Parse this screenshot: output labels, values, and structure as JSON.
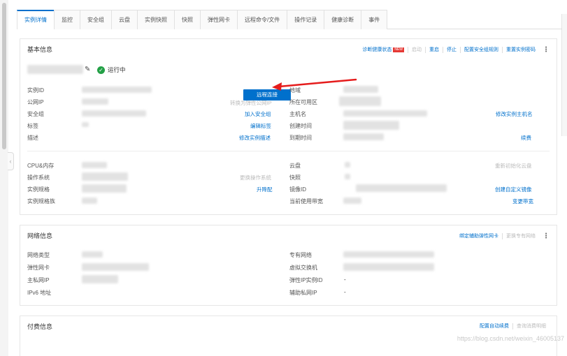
{
  "tabs": [
    "实例详情",
    "监控",
    "安全组",
    "云盘",
    "实例快照",
    "快照",
    "弹性网卡",
    "远程命令/文件",
    "操作记录",
    "健康诊断",
    "事件"
  ],
  "basic": {
    "title": "基本信息",
    "actions": {
      "diagnose": "诊断健康状态",
      "diagnose_badge": "NEW",
      "start": "启动",
      "restart": "重启",
      "stop": "停止",
      "config_sg": "配置安全组规则",
      "reset_pwd": "重置实例密码"
    },
    "status": "运行中",
    "remote_btn": "远程连接",
    "left_labels": {
      "instance_id": "实例ID",
      "public_ip": "公网IP",
      "security_group": "安全组",
      "tags": "标签",
      "description": "描述",
      "cpu_mem": "CPU&内存",
      "os": "操作系统",
      "spec": "实例规格",
      "spec_family": "实例规格族"
    },
    "left_links": {
      "to_eip": "转换为弹性公网IP",
      "join_sg": "加入安全组",
      "edit_tags": "编辑标签",
      "edit_desc": "修改实例描述",
      "change_os": "更换操作系统",
      "upgrade": "升降配"
    },
    "right_labels": {
      "region": "地域",
      "zone": "所在可用区",
      "hostname": "主机名",
      "created": "创建时间",
      "expire": "到期时间",
      "cloud_disk": "云盘",
      "snapshot": "快照",
      "image_id": "镜像ID",
      "current_plan": "当前使用带宽"
    },
    "right_links": {
      "edit_hostname": "修改实例主机名",
      "renew": "续费",
      "reinit_disk": "重新初始化云盘",
      "create_image": "创建自定义镜像",
      "change_bw": "变更带宽"
    }
  },
  "network": {
    "title": "网络信息",
    "actions": {
      "bind_eni": "绑定辅助弹性网卡",
      "change_vpc": "更换专有网络"
    },
    "left_labels": {
      "net_type": "网络类型",
      "eni": "弹性网卡",
      "private_ip": "主私网IP",
      "ipv6": "IPv6 地址"
    },
    "right_labels": {
      "vpc": "专有网络",
      "vswitch": "虚拟交换机",
      "eip_id": "弹性IP实例ID",
      "secondary_ip": "辅助私网IP"
    },
    "right_values": {
      "eip_id": "-",
      "secondary_ip": "-"
    }
  },
  "billing": {
    "title": "付费信息",
    "actions": {
      "auto_renew": "配置自动续费",
      "query_detail": "查询消费明细"
    }
  },
  "watermark": "https://blog.csdn.net/weixin_46005137"
}
